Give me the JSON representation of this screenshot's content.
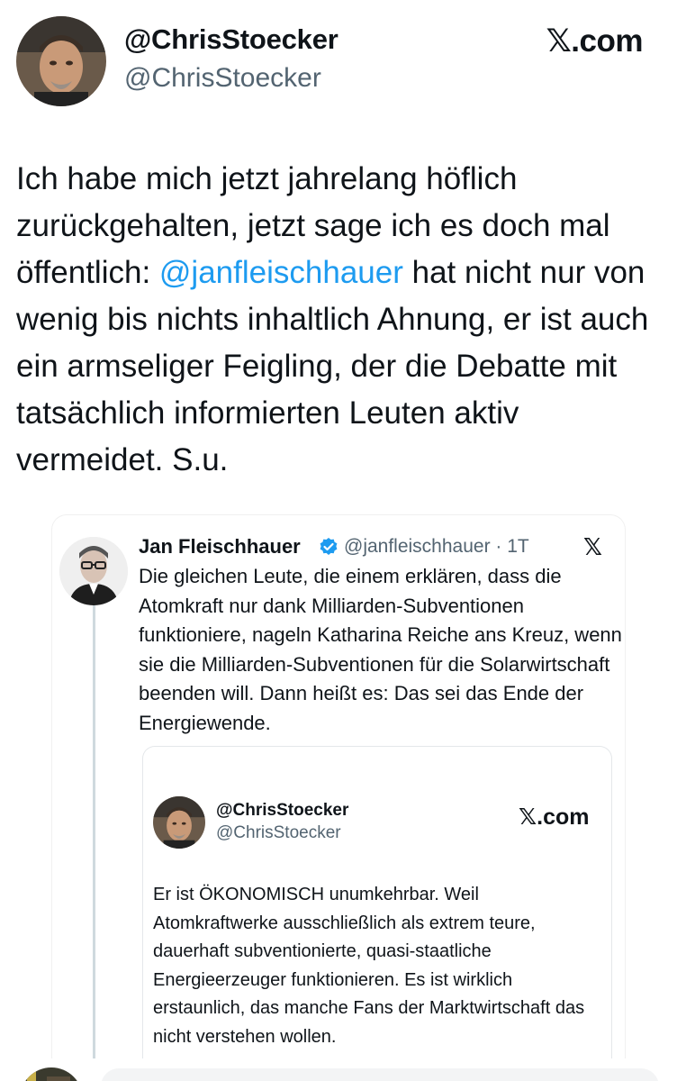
{
  "author": {
    "display_name": "@ChrisStoecker",
    "handle": "@ChrisStoecker",
    "brand": "𝕏.com",
    "avatar_icon": "profile-photo-man-icon"
  },
  "tweet": {
    "text_before": "Ich habe mich jetzt jahrelang höflich zurückgehalten, jetzt sage ich es doch mal öffentlich: ",
    "mention": "@janfleischhauer",
    "text_after": " hat nicht nur von wenig bis nichts inhaltlich Ahnung, er ist auch ein armseliger Feigling, der die Debatte mit tatsächlich informierten Leuten aktiv vermeidet. S.u."
  },
  "quoted": {
    "name": "Jan Fleischhauer",
    "verified_icon": "verified-badge-icon",
    "handle_time": "@janfleischhauer · 1T",
    "x_icon": "𝕏",
    "text": "Die gleichen Leute, die einem erklären, dass die Atomkraft nur dank Milliarden-Subventionen funktioniere, nageln Katharina Reiche ans Kreuz, wenn sie die Milliarden-Subventionen für die Solarwirtschaft beenden will. Dann heißt es: Das sei das Ende der Energiewende."
  },
  "inner_quote": {
    "display_name": "@ChrisStoecker",
    "handle": "@ChrisStoecker",
    "brand": "𝕏.com",
    "text": "Er ist ÖKONOMISCH unumkehrbar. Weil Atomkraftwerke ausschließlich als extrem teure, dauerhaft subventionierte, quasi-staatliche Energieerzeuger funktionieren. Es ist wirklich erstaunlich, das manche Fans der Marktwirtschaft das nicht verstehen wollen."
  },
  "colors": {
    "mention": "#1d9bf0",
    "secondary_text": "#536471",
    "verified": "#1d9bf0"
  }
}
